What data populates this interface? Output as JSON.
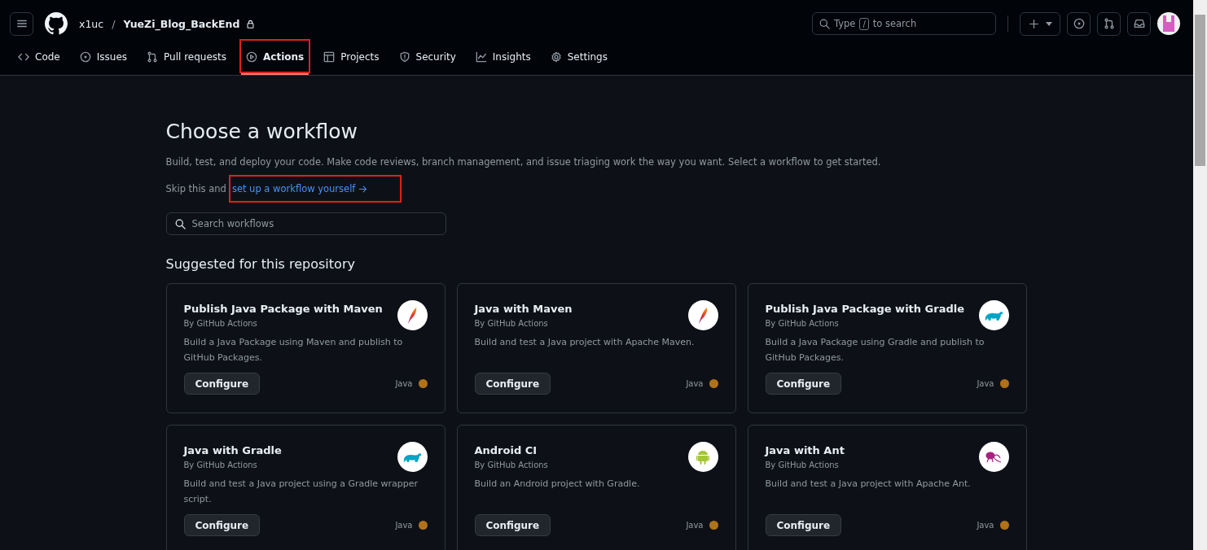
{
  "header": {
    "owner": "x1uc",
    "separator": "/",
    "repo": "YueZi_Blog_BackEnd",
    "private": true,
    "search": {
      "prefix": "Type",
      "key": "/",
      "suffix": "to search"
    }
  },
  "tabs": [
    {
      "label": "Code",
      "kind": "code",
      "selected": false,
      "highlighted": false
    },
    {
      "label": "Issues",
      "kind": "issue",
      "selected": false,
      "highlighted": false
    },
    {
      "label": "Pull requests",
      "kind": "pr",
      "selected": false,
      "highlighted": false
    },
    {
      "label": "Actions",
      "kind": "play",
      "selected": true,
      "highlighted": true
    },
    {
      "label": "Projects",
      "kind": "table",
      "selected": false,
      "highlighted": false
    },
    {
      "label": "Security",
      "kind": "shield",
      "selected": false,
      "highlighted": false
    },
    {
      "label": "Insights",
      "kind": "graph",
      "selected": false,
      "highlighted": false
    },
    {
      "label": "Settings",
      "kind": "gear",
      "selected": false,
      "highlighted": false
    }
  ],
  "page": {
    "title": "Choose a workflow",
    "description": "Build, test, and deploy your code. Make code reviews, branch management, and issue triaging work the way you want. Select a workflow to get started.",
    "skip_text": "Skip this and",
    "skip_link": "set up a workflow yourself",
    "skip_link_highlighted": true,
    "search_placeholder": "Search workflows",
    "section_title": "Suggested for this repository"
  },
  "workflows": [
    {
      "title": "Publish Java Package with Maven",
      "author": "By GitHub Actions",
      "description": "Build a Java Package using Maven and publish to GitHub Packages.",
      "button": "Configure",
      "language": "Java",
      "color": "#b07219",
      "kind": "feather"
    },
    {
      "title": "Java with Maven",
      "author": "By GitHub Actions",
      "description": "Build and test a Java project with Apache Maven.",
      "button": "Configure",
      "language": "Java",
      "color": "#b07219",
      "kind": "feather"
    },
    {
      "title": "Publish Java Package with Gradle",
      "author": "By GitHub Actions",
      "description": "Build a Java Package using Gradle and publish to GitHub Packages.",
      "button": "Configure",
      "language": "Java",
      "color": "#b07219",
      "kind": "elephant"
    },
    {
      "title": "Java with Gradle",
      "author": "By GitHub Actions",
      "description": "Build and test a Java project using a Gradle wrapper script.",
      "button": "Configure",
      "language": "Java",
      "color": "#b07219",
      "kind": "elephant"
    },
    {
      "title": "Android CI",
      "author": "By GitHub Actions",
      "description": "Build an Android project with Gradle.",
      "button": "Configure",
      "language": "Java",
      "color": "#b07219",
      "kind": "android"
    },
    {
      "title": "Java with Ant",
      "author": "By GitHub Actions",
      "description": "Build and test a Java project with Apache Ant.",
      "button": "Configure",
      "language": "Java",
      "color": "#b07219",
      "kind": "ant"
    }
  ]
}
